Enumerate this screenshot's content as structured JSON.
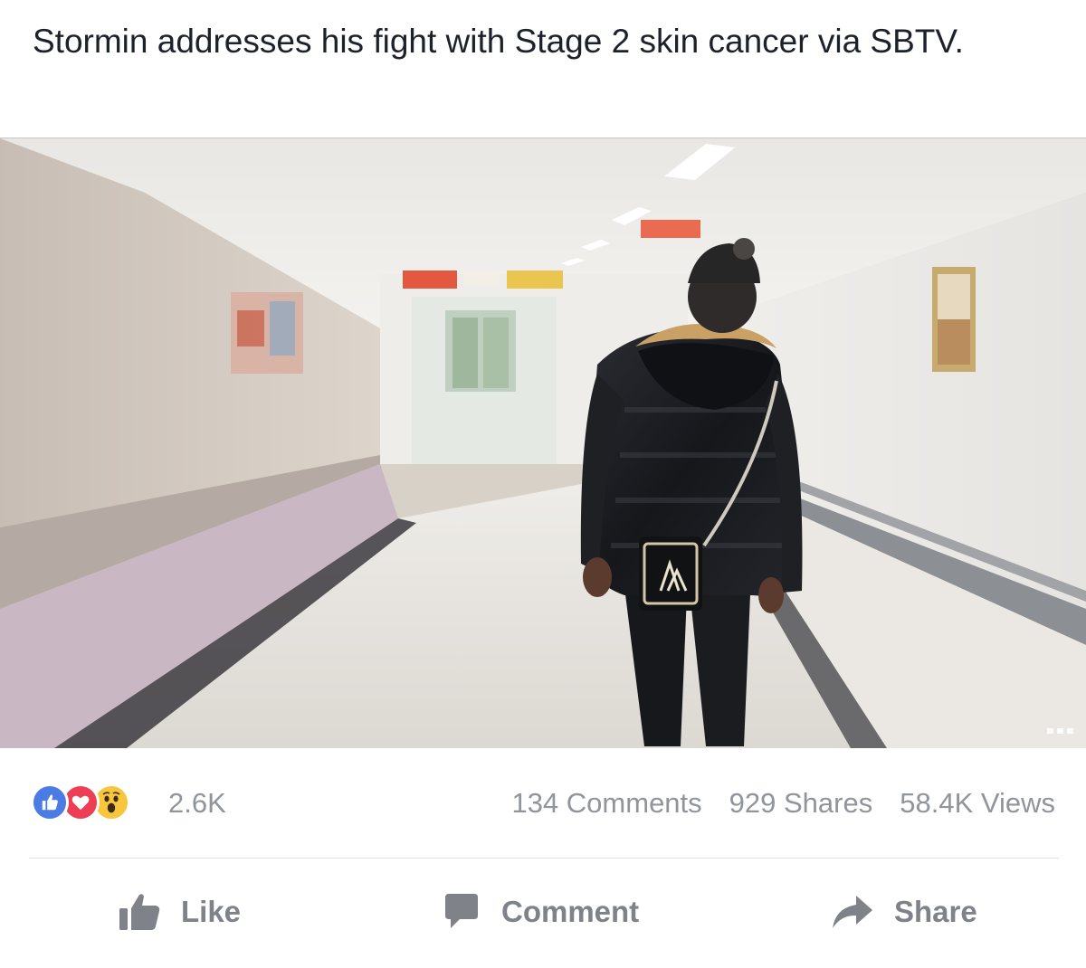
{
  "post": {
    "caption": "Stormin addresses his fight with Stage 2 skin cancer via SBTV."
  },
  "video": {
    "scene": "hospital-corridor-video-frame"
  },
  "stats": {
    "reaction_icons": [
      "like-reaction-icon",
      "love-reaction-icon",
      "wow-reaction-icon"
    ],
    "reaction_count": "2.6K",
    "comments": "134 Comments",
    "shares": "929 Shares",
    "views": "58.4K Views"
  },
  "actions": {
    "like_label": "Like",
    "comment_label": "Comment",
    "share_label": "Share"
  },
  "colors": {
    "text": "#1d2129",
    "meta": "#90949c",
    "action": "#7f8289",
    "like_blue": "#4b7be5",
    "love_red": "#ee3e54",
    "wow_yellow": "#f7c63d"
  }
}
